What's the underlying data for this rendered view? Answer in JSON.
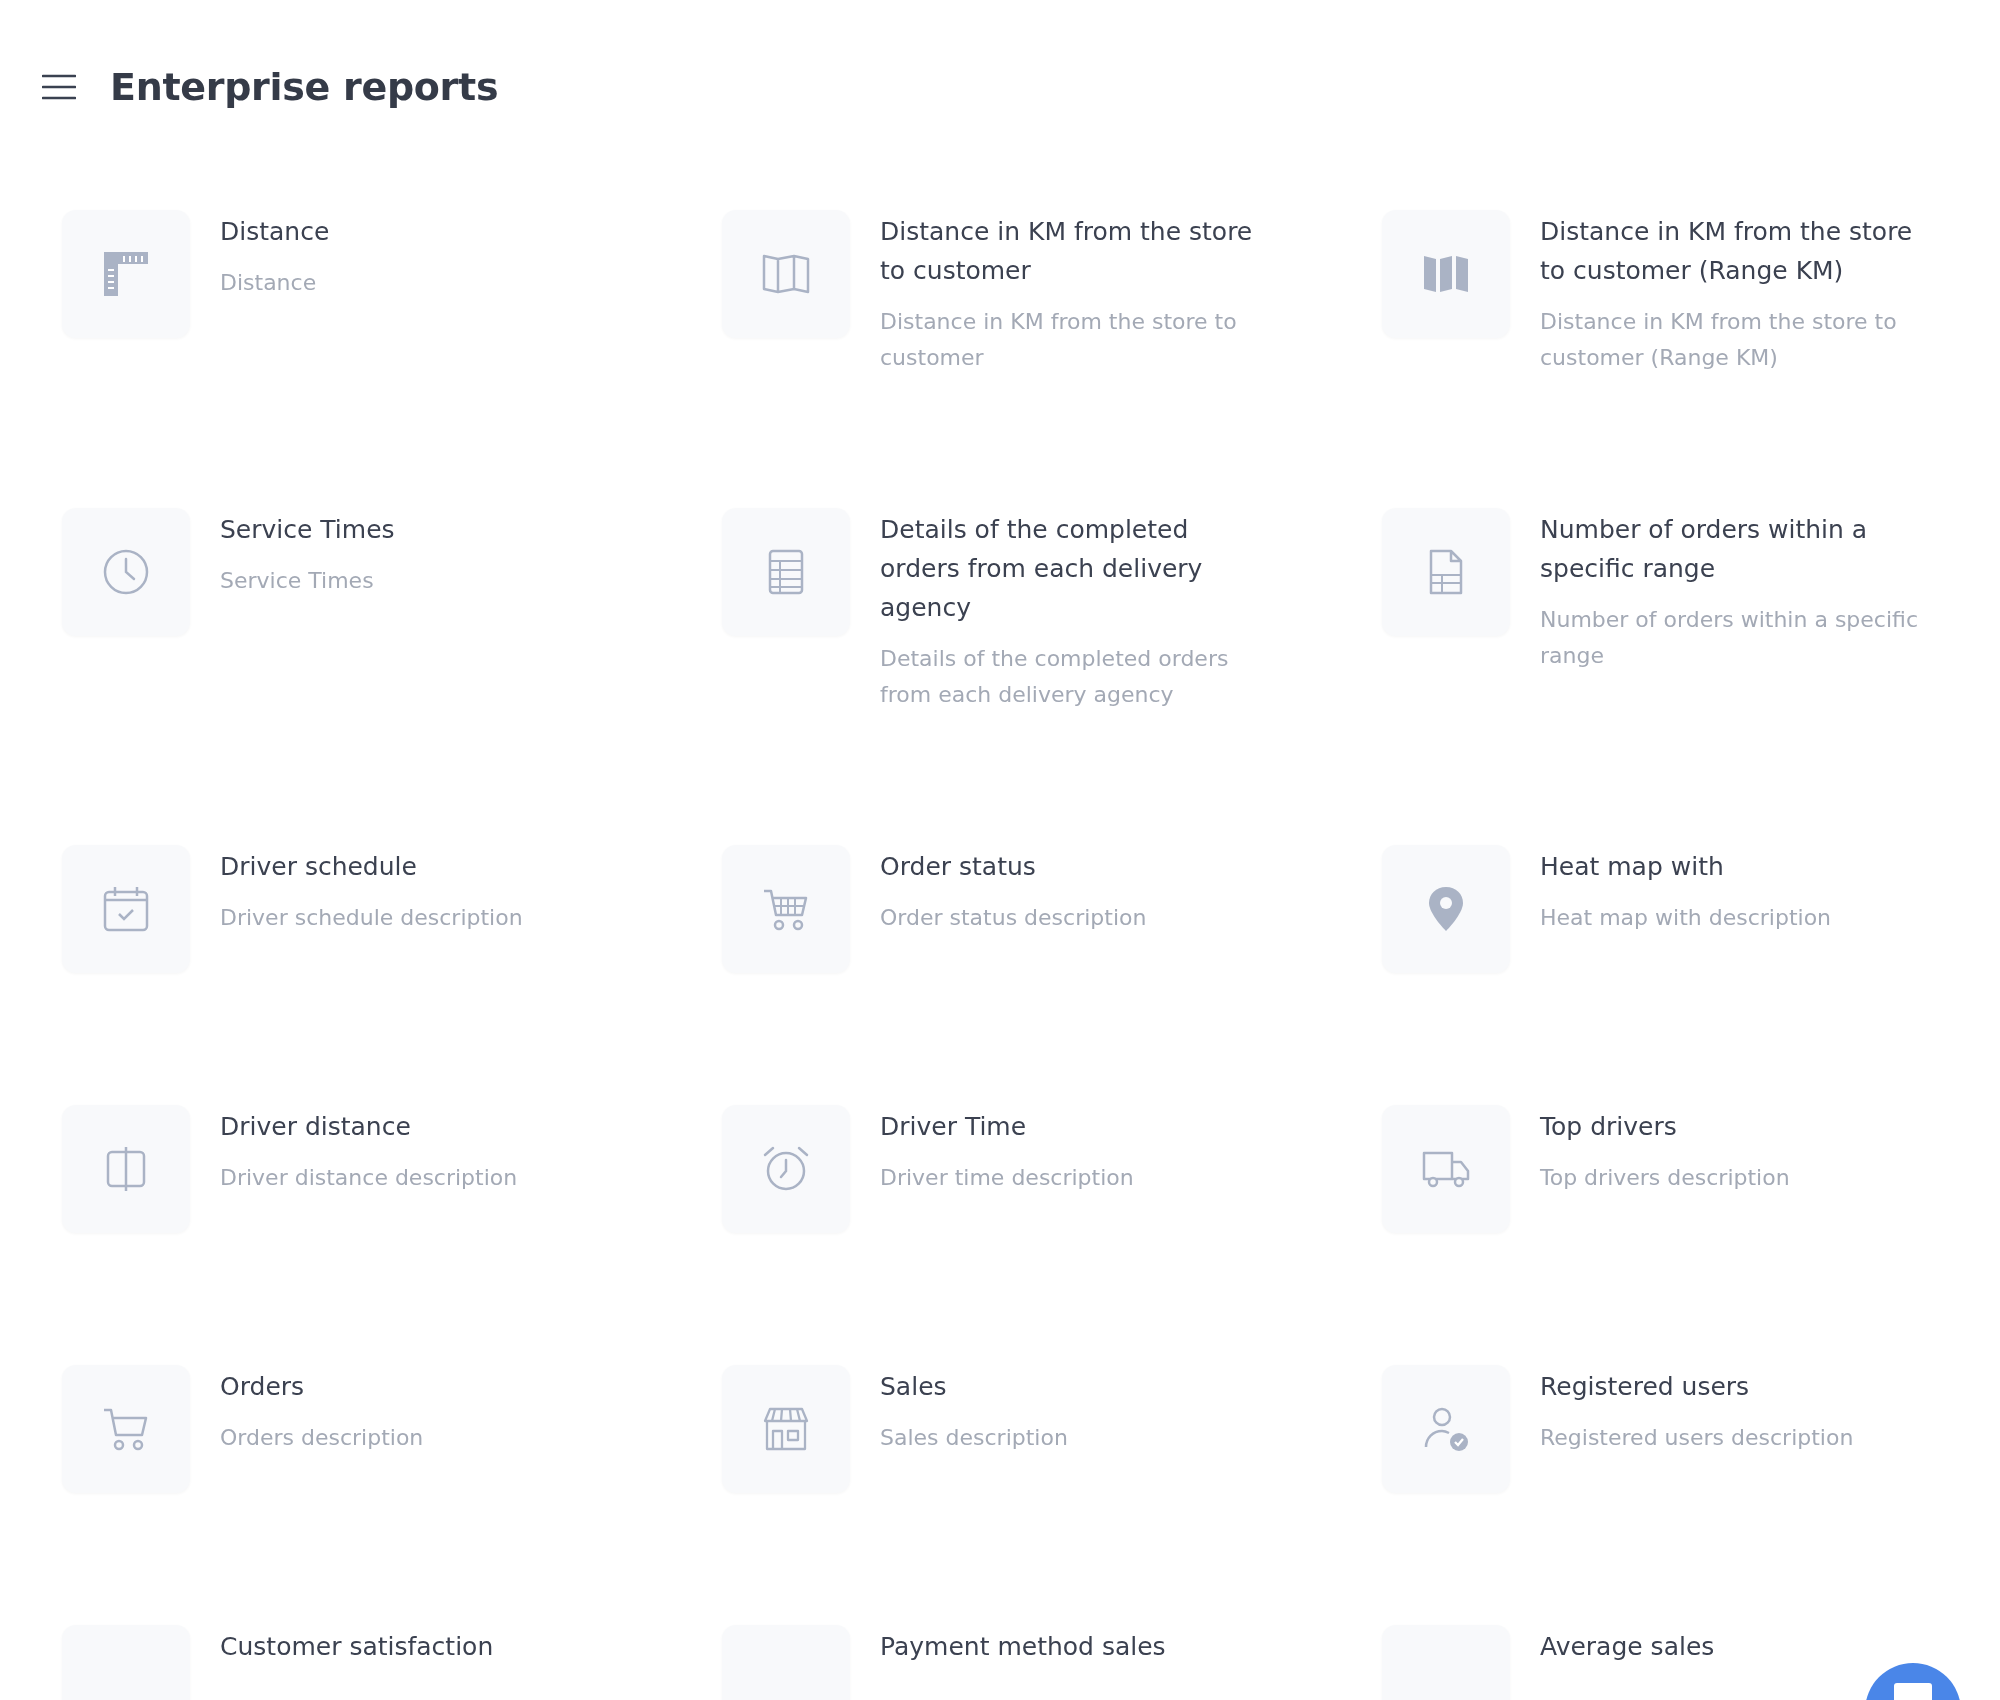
{
  "header": {
    "title": "Enterprise reports"
  },
  "reports": [
    {
      "title": "Distance",
      "description": "Distance"
    },
    {
      "title": "Distance in KM from the store to customer",
      "description": "Distance in KM from the store to customer"
    },
    {
      "title": "Distance in KM from the store to customer (Range KM)",
      "description": "Distance in KM from the store to customer (Range KM)"
    },
    {
      "title": "Service Times",
      "description": "Service Times"
    },
    {
      "title": "Details of the completed orders from each delivery agency",
      "description": "Details of the completed orders from each delivery agency"
    },
    {
      "title": "Number of orders within a specific range",
      "description": "Number of orders within a specific range"
    },
    {
      "title": "Driver schedule",
      "description": "Driver schedule description"
    },
    {
      "title": "Order status",
      "description": "Order status description"
    },
    {
      "title": "Heat map with",
      "description": "Heat map with description"
    },
    {
      "title": "Driver distance",
      "description": "Driver distance description"
    },
    {
      "title": "Driver Time",
      "description": "Driver time description"
    },
    {
      "title": "Top drivers",
      "description": "Top drivers description"
    },
    {
      "title": "Orders",
      "description": "Orders description"
    },
    {
      "title": "Sales",
      "description": "Sales description"
    },
    {
      "title": "Registered users",
      "description": "Registered users description"
    },
    {
      "title": "Customer satisfaction"
    },
    {
      "title": "Payment method sales"
    },
    {
      "title": "Average sales"
    }
  ]
}
